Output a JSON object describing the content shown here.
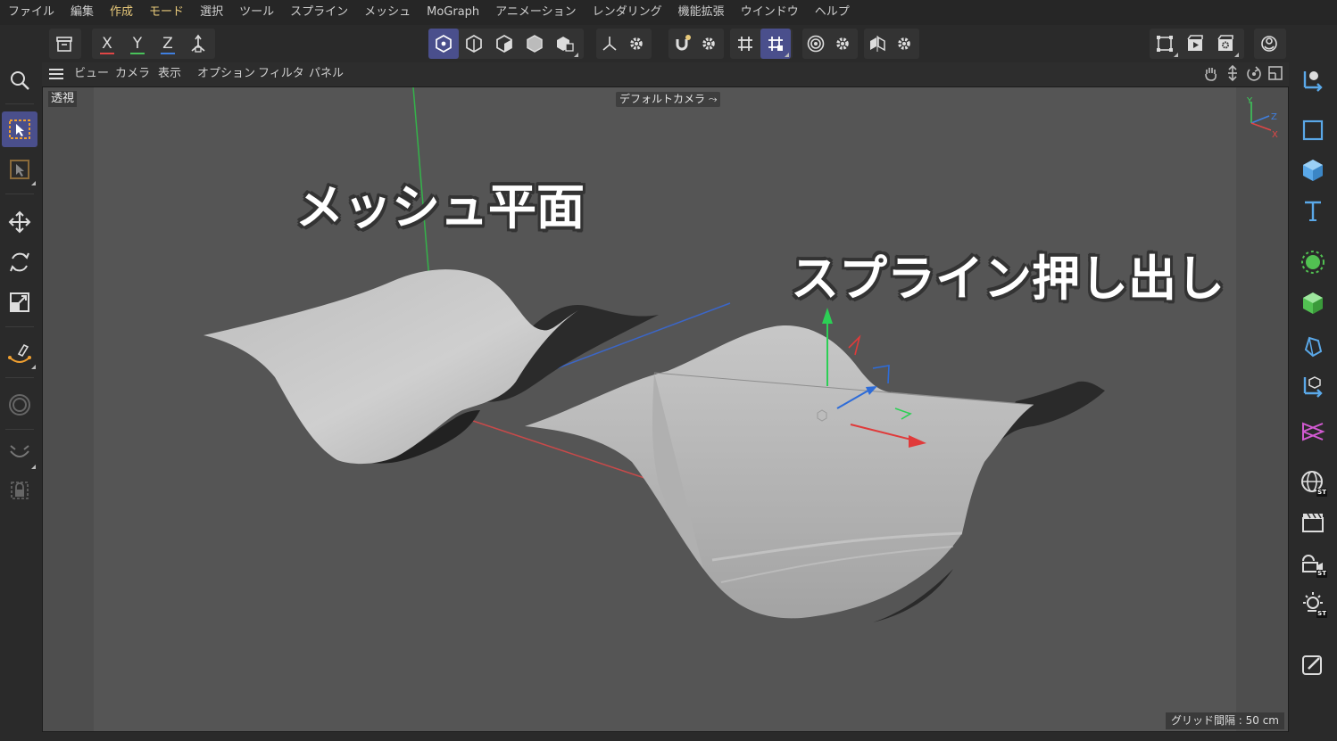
{
  "menu": [
    "ファイル",
    "編集",
    "作成",
    "モード",
    "選択",
    "ツール",
    "スプライン",
    "メッシュ",
    "MoGraph",
    "アニメーション",
    "レンダリング",
    "機能拡張",
    "ウインドウ",
    "ヘルプ"
  ],
  "menu_active": [
    "作成",
    "モード"
  ],
  "toolbar": {
    "axis_x": "X",
    "axis_y": "Y",
    "axis_z": "Z",
    "colors": {
      "x": "#e04646",
      "y": "#49c25a",
      "z": "#3f7fe0",
      "accent": "#4a4f8c"
    }
  },
  "view_menu": [
    "ビュー",
    "カメラ",
    "表示",
    "オプション",
    "フィルタ",
    "パネル"
  ],
  "viewport": {
    "mode_label": "透視",
    "camera_label": "デフォルトカメラ",
    "grid_label": "グリッド間隔 : 50 cm",
    "annotation_left": "メッシュ平面",
    "annotation_right": "スプライン押し出し",
    "axis_gizmo": {
      "y": "Y",
      "z": "Z",
      "x": "X"
    }
  },
  "left_tools": [
    "search-icon",
    "select-icon",
    "select-frame-icon",
    "move-icon",
    "rotate-icon",
    "scale-icon",
    "spline-pen-icon",
    "radial-icon",
    "brush-icon",
    "lock-icon"
  ],
  "right_tools": [
    "object-manager-icon",
    "square-icon",
    "cube-icon",
    "text-icon",
    "generator-icon",
    "deformer-icon",
    "volume-icon",
    "spline-tool-icon",
    "joint-icon",
    "globe-icon",
    "clapper-icon",
    "camera-icon",
    "light-icon",
    "edit-icon"
  ]
}
